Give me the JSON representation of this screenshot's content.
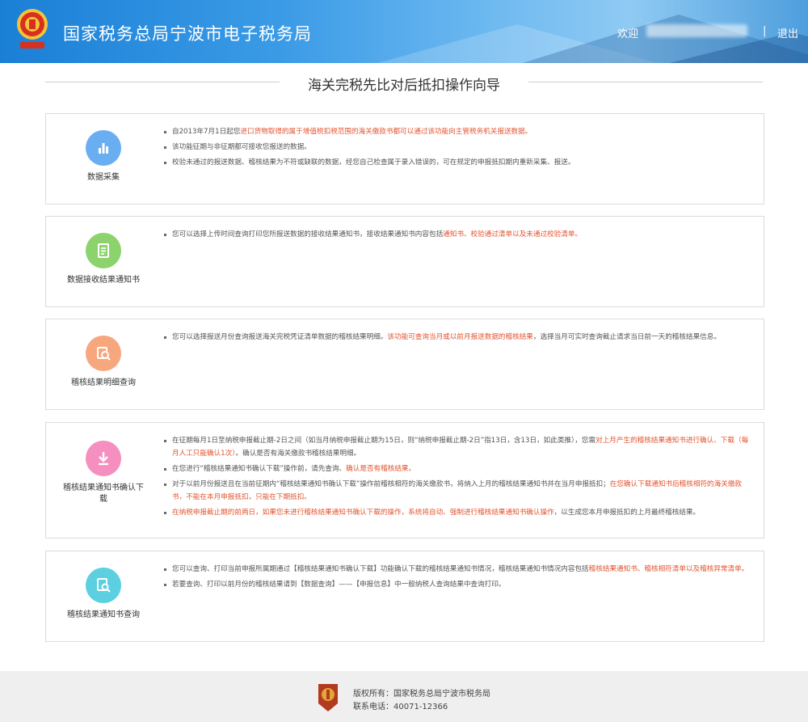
{
  "header": {
    "title": "国家税务总局宁波市电子税务局",
    "welcome": "欢迎",
    "separator": "|",
    "logout": "退出"
  },
  "page": {
    "title": "海关完税先比对后抵扣操作向导"
  },
  "sections": [
    {
      "label": "数据采集",
      "icon": "bar-chart-icon",
      "color": "#6aaef2",
      "bullets": [
        [
          {
            "t": "自2013年7月1日起您",
            "r": false
          },
          {
            "t": "进口货物取得的属于增值税扣税范围的海关缴款书都可以通过该功能向主管税务机关报送数据。",
            "r": true
          }
        ],
        [
          {
            "t": "该功能征期与非征期都可接收您报送的数据。",
            "r": false
          }
        ],
        [
          {
            "t": "校验未通过的报送数据、稽核结果为不符或缺联的数据，经您自己检查属于录入错误的，可在规定的申报抵扣期内重新采集、报送。",
            "r": false
          }
        ]
      ]
    },
    {
      "label": "数据接收结果通知书",
      "icon": "document-icon",
      "color": "#8cd36e",
      "bullets": [
        [
          {
            "t": "您可以选择上传时间查询打印您所报送数据的接收结果通知书，接收结果通知书内容包括",
            "r": false
          },
          {
            "t": "通知书、校验通过清单以及未通过校验清单。",
            "r": true
          }
        ]
      ]
    },
    {
      "label": "稽核结果明细查询",
      "icon": "search-detail-icon",
      "color": "#f7a77e",
      "bullets": [
        [
          {
            "t": "您可以选择报送月份查询报送海关完税凭证清单数据的稽核结果明细。",
            "r": false
          },
          {
            "t": "该功能可查询当月或以前月报送数据的稽核结果",
            "r": true
          },
          {
            "t": "，选择当月可实时查询截止请求当日前一天的稽核结果信息。",
            "r": false
          }
        ]
      ]
    },
    {
      "label": "稽核结果通知书确认下载",
      "icon": "download-icon",
      "color": "#f58fbf",
      "bullets": [
        [
          {
            "t": "在征期每月1日至纳税申报截止期-2日之间（如当月纳税申报截止期为15日，则“纳税申报截止期-2日”指13日，含13日，如此类推），您需",
            "r": false
          },
          {
            "t": "对上月产生的稽核结果通知书进行确认、下载（每月人工只能确认1次）",
            "r": true
          },
          {
            "t": "。确认是否有海关缴款书稽核结果明细。",
            "r": false
          }
        ],
        [
          {
            "t": "在您进行“稽核结果通知书确认下载”操作前，请先查询、",
            "r": false
          },
          {
            "t": "确认是否有稽核结果。",
            "r": true
          }
        ],
        [
          {
            "t": "对于以前月份报送且在当前征期内“稽核结果通知书确认下载”操作前稽核相符的海关缴款书，将纳入上月的稽核结果通知书并在当月申报抵扣；",
            "r": false
          },
          {
            "t": "在您确认下载通知书后稽核相符的海关缴款书，不能在本月申报抵扣，只能在下期抵扣。",
            "r": true
          }
        ],
        [
          {
            "t": "在纳税申报截止期的前两日，如果您未进行稽核结果通知书确认下载的操作，系统将自动、强制进行稽核结果通知书确认操作",
            "r": true
          },
          {
            "t": "，以生成您本月申报抵扣的上月最终稽核结果。",
            "r": false
          }
        ]
      ]
    },
    {
      "label": "稽核结果通知书查询",
      "icon": "magnify-document-icon",
      "color": "#5ccfe0",
      "bullets": [
        [
          {
            "t": "您可以查询、打印当前申报所属期通过【稽核结果通知书确认下载】功能确认下载的稽核结果通知书情况，稽核结果通知书情况内容包括",
            "r": false
          },
          {
            "t": "稽核结果通知书、稽核相符清单以及稽核异常清单。",
            "r": true
          }
        ],
        [
          {
            "t": "若要查询、打印以前月份的稽核结果请到【数据查询】——【申报信息】中一般纳税人查询结果中查询打印。",
            "r": false
          }
        ]
      ]
    }
  ],
  "footer": {
    "copyright": "版权所有：国家税务总局宁波市税务局",
    "phone": "联系电话：40071-12366"
  }
}
